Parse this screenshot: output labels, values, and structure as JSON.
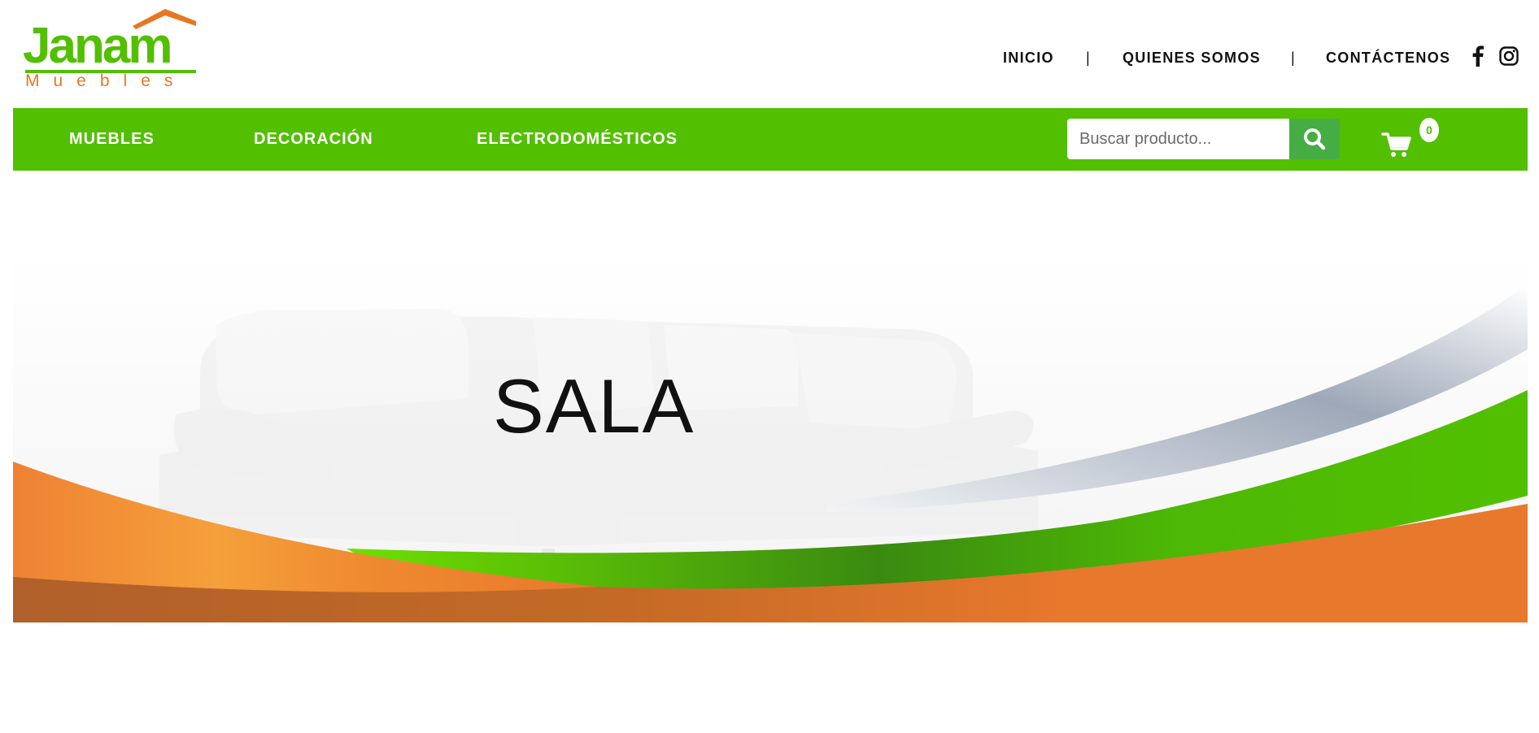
{
  "brand": {
    "name": "Janam",
    "tagline": "Muebles"
  },
  "top_nav": [
    {
      "label": "INICIO"
    },
    {
      "label": "QUIENES SOMOS"
    },
    {
      "label": "CONTÁCTENOS"
    }
  ],
  "separator": "|",
  "social": {
    "facebook": "facebook-icon",
    "instagram": "instagram-icon"
  },
  "categories": [
    {
      "label": "MUEBLES"
    },
    {
      "label": "DECORACIÓN"
    },
    {
      "label": "ELECTRODOMÉSTICOS"
    }
  ],
  "search": {
    "placeholder": "Buscar producto...",
    "value": ""
  },
  "cart": {
    "count": "0"
  },
  "hero": {
    "title": "SALA"
  },
  "colors": {
    "green": "#52bf00",
    "orange": "#e87722",
    "search_button": "#46ad44"
  }
}
